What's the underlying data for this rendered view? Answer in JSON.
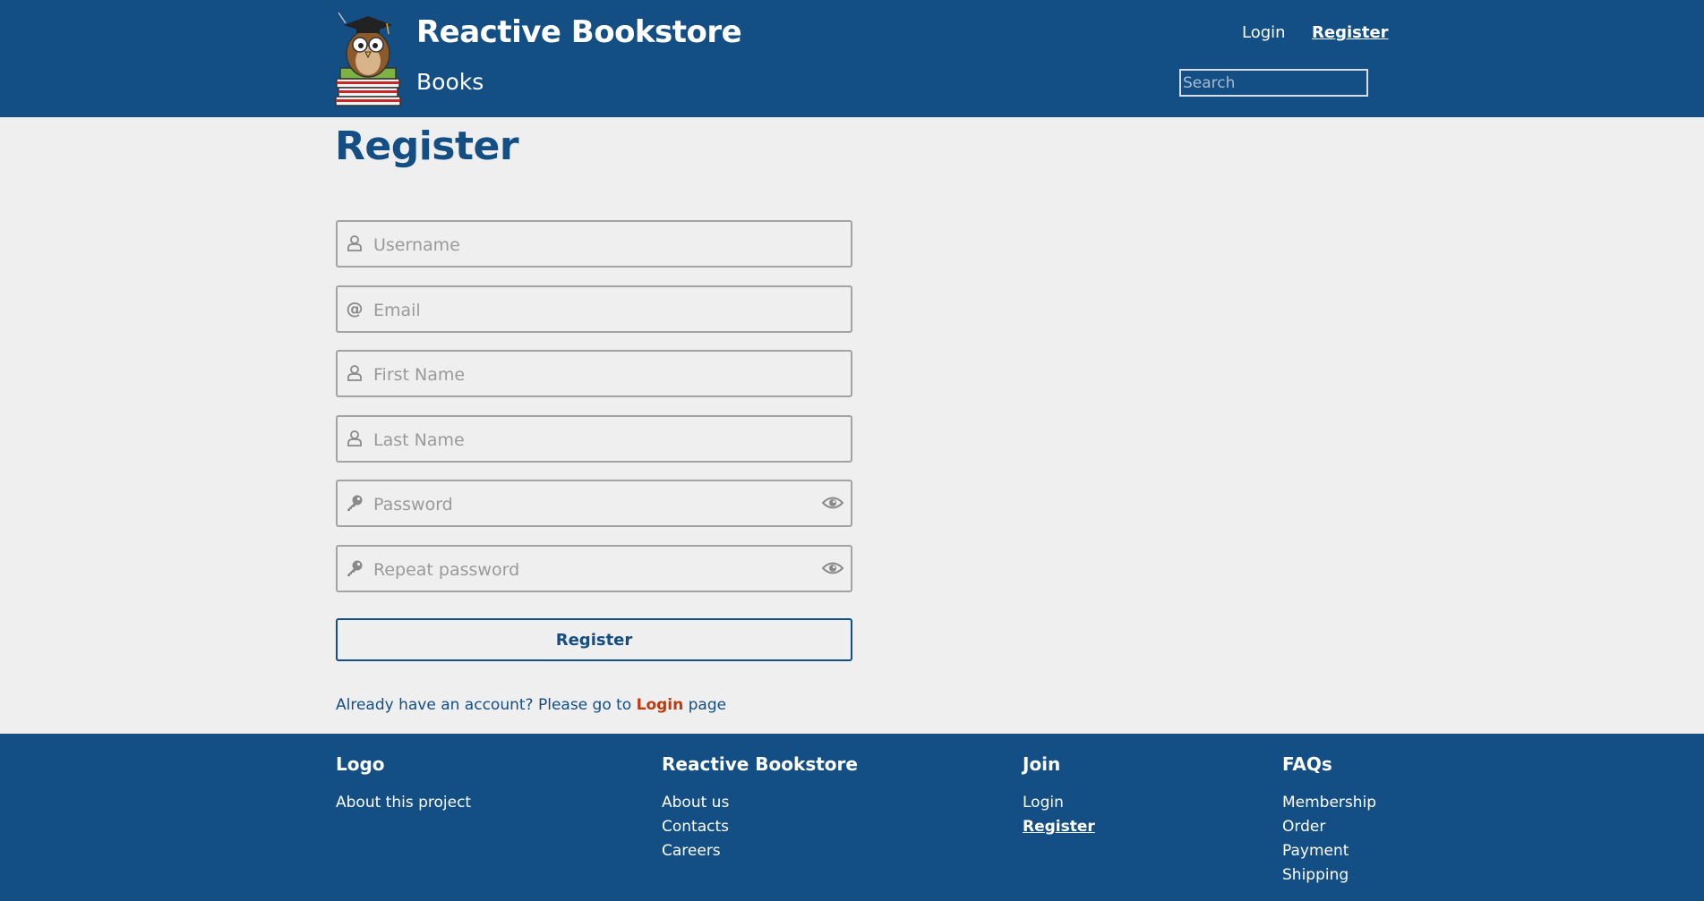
{
  "header": {
    "site_title": "Reactive Bookstore",
    "nav_books": "Books",
    "login_label": "Login",
    "register_label": "Register",
    "search_placeholder": "Search"
  },
  "main": {
    "page_title": "Register",
    "fields": [
      {
        "placeholder": "Username",
        "icon": "user-icon"
      },
      {
        "placeholder": "Email",
        "icon": "at-icon"
      },
      {
        "placeholder": "First Name",
        "icon": "user-icon"
      },
      {
        "placeholder": "Last Name",
        "icon": "user-icon"
      },
      {
        "placeholder": "Password",
        "icon": "key-icon",
        "toggle": "eye-icon"
      },
      {
        "placeholder": "Repeat password",
        "icon": "key-icon",
        "toggle": "eye-icon"
      }
    ],
    "register_button": "Register",
    "already_prefix": "Already have an account? Please go to ",
    "already_link": "Login",
    "already_suffix": " page"
  },
  "footer": {
    "columns": [
      {
        "heading": "Logo",
        "links": [
          "About this project"
        ]
      },
      {
        "heading": "Reactive Bookstore",
        "links": [
          "About us",
          "Contacts",
          "Careers"
        ]
      },
      {
        "heading": "Join",
        "links": [
          "Login",
          "Register"
        ]
      },
      {
        "heading": "FAQs",
        "links": [
          "Membership",
          "Order",
          "Payment",
          "Shipping"
        ]
      }
    ]
  },
  "colors": {
    "brand": "#134e84",
    "background": "#efefef",
    "link_accent": "#c0390b"
  }
}
